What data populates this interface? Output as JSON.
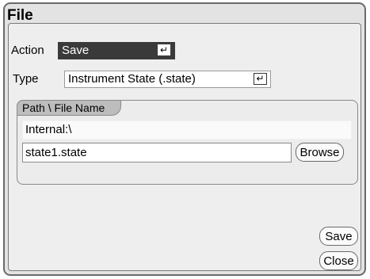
{
  "window": {
    "title": "File"
  },
  "action": {
    "label": "Action",
    "value": "Save",
    "enter_glyph": "↵"
  },
  "type": {
    "label": "Type",
    "value": "Instrument State (.state)",
    "enter_glyph": "↵"
  },
  "path_group": {
    "title": "Path \\ File Name",
    "path": "Internal:\\",
    "filename": "state1.state",
    "browse_label": "Browse"
  },
  "buttons": {
    "save_label": "Save",
    "close_label": "Close"
  },
  "icons": {
    "enter": "enter-key-icon"
  }
}
